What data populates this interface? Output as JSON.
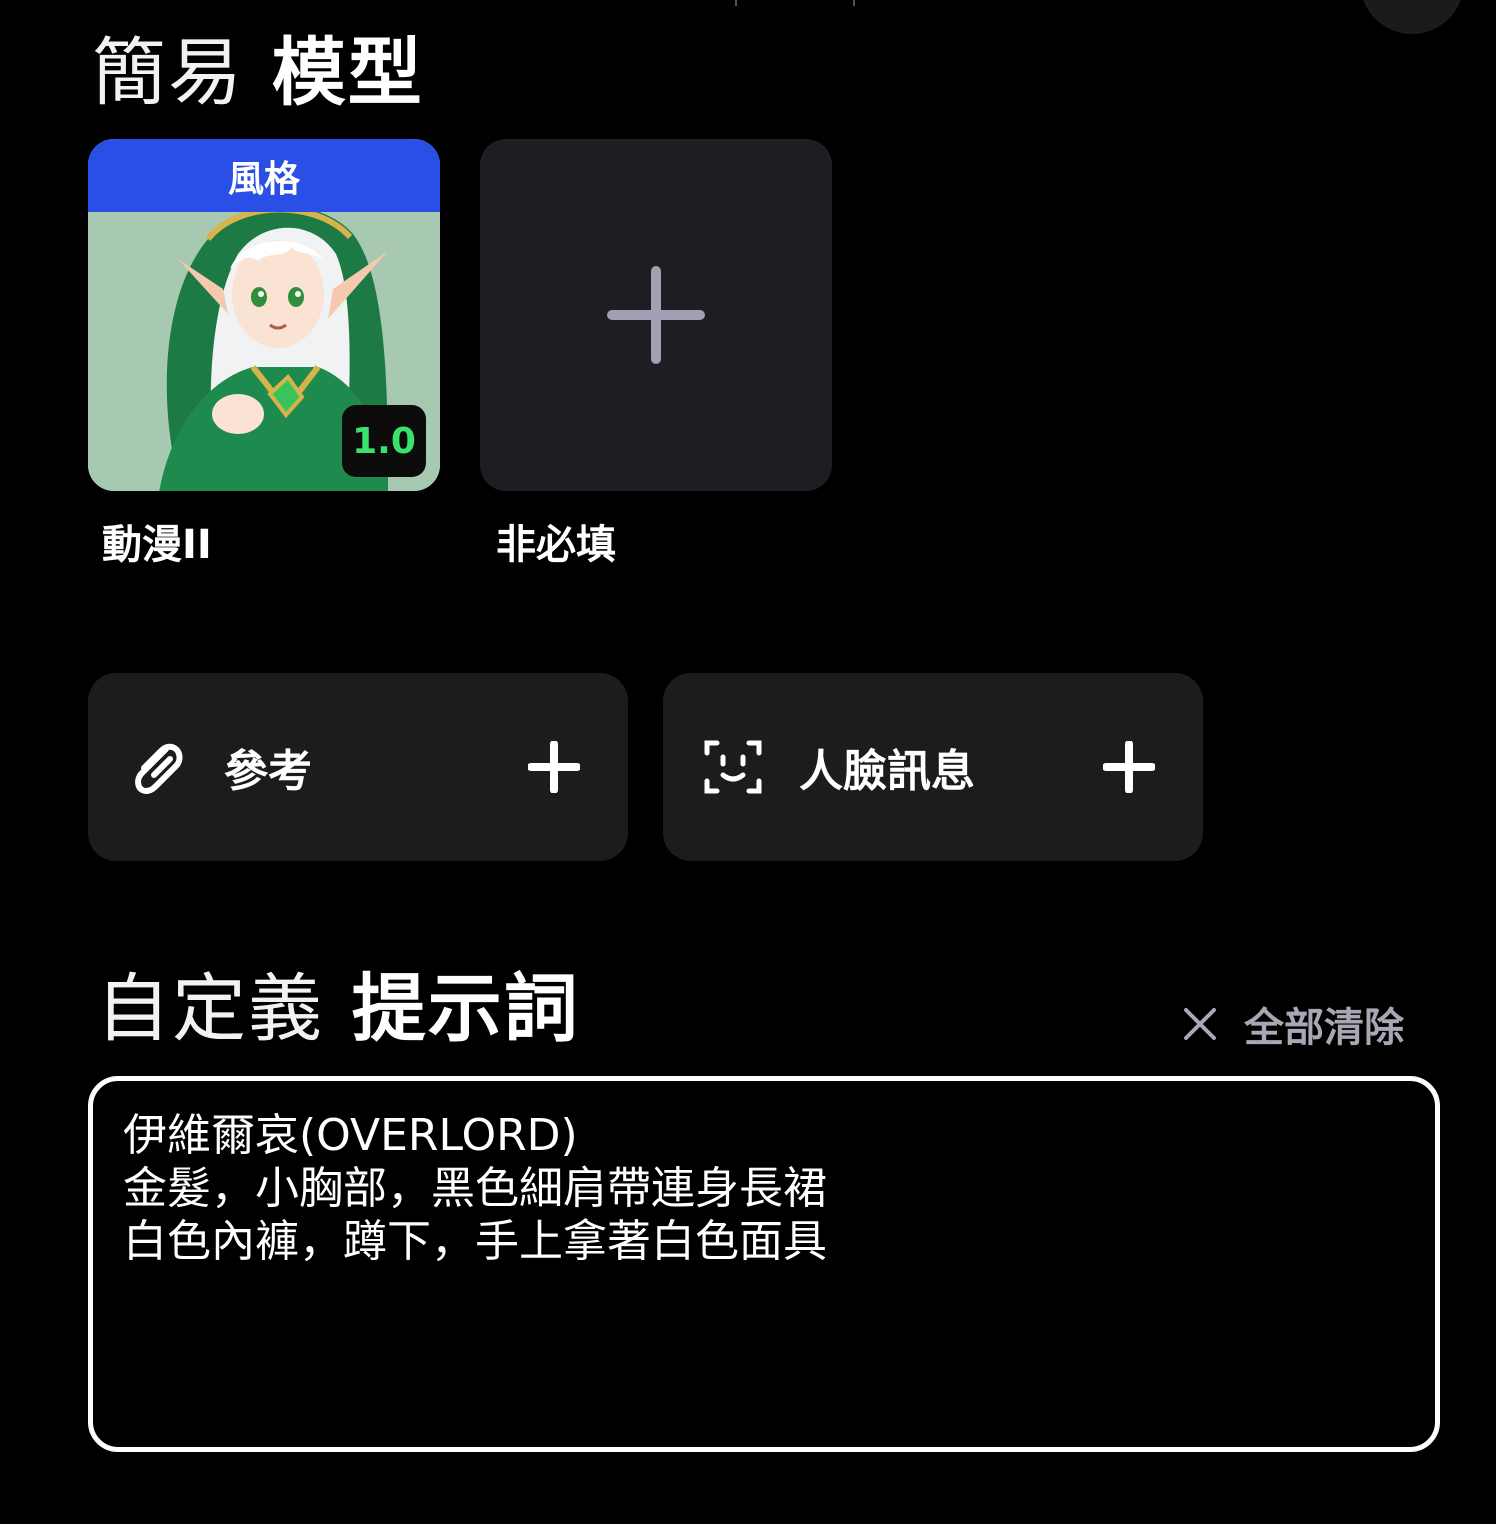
{
  "model_section": {
    "title_light": "簡易",
    "title_bold": "模型"
  },
  "style_card": {
    "banner": "風格",
    "weight": "1.0",
    "label": "動漫II",
    "image_icon": "anime-elf-portrait"
  },
  "add_card": {
    "label": "非必填",
    "icon": "plus-icon"
  },
  "options": {
    "reference": {
      "label": "參考",
      "icon": "paperclip-icon"
    },
    "face": {
      "label": "人臉訊息",
      "icon": "face-scan-icon"
    }
  },
  "prompt_section": {
    "title_light": "自定義",
    "title_bold": "提示詞",
    "clear_all": "全部清除",
    "lines": [
      "伊維爾哀(OVERLORD)",
      "金髮，小胸部，黑色細肩帶連身長裙",
      "白色內褲，蹲下，手上拿著白色面具"
    ]
  },
  "colors": {
    "background": "#000000",
    "card_bg": "#1c1c1f",
    "style_banner": "#2a4fe6",
    "weight_text": "#39e36a",
    "muted_text": "#a8a8b4"
  }
}
